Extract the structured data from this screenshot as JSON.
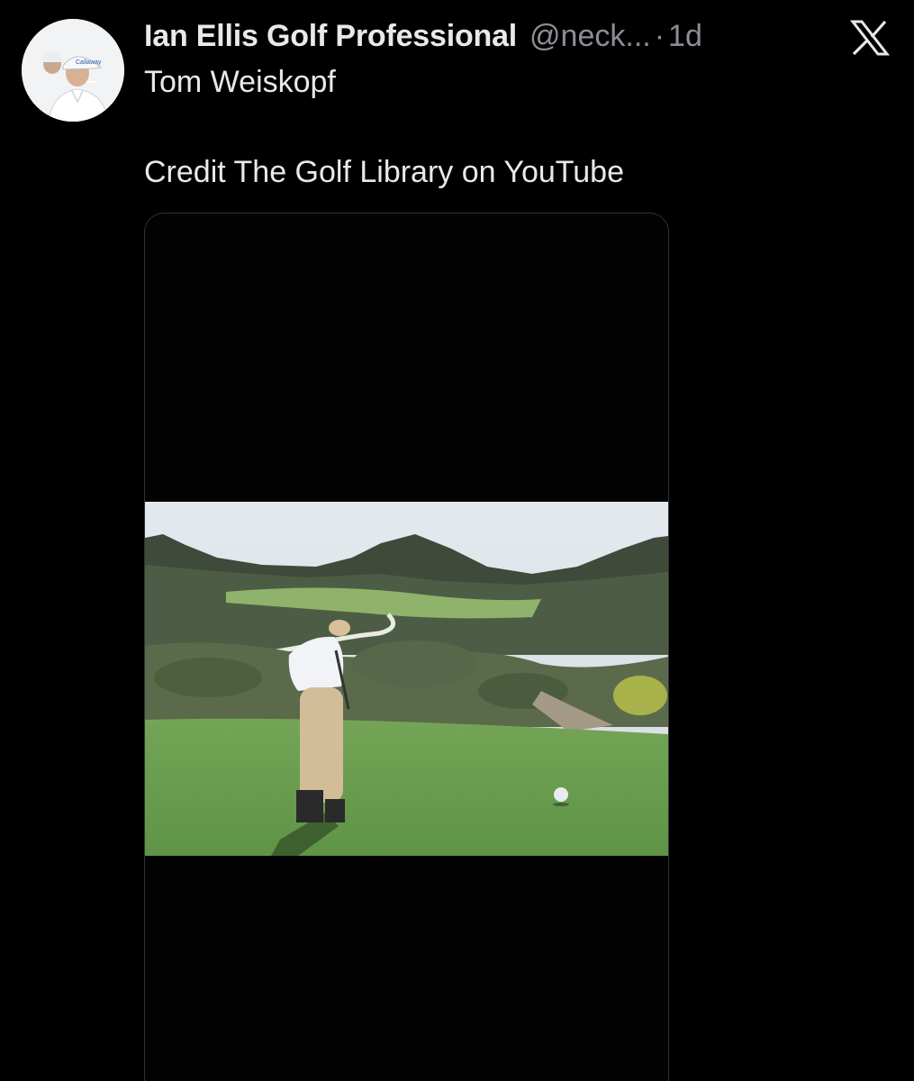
{
  "post": {
    "author_name": "Ian Ellis Golf Professional",
    "author_handle": "@neck...",
    "separator": "·",
    "time": "1d",
    "text_line_1": "Tom Weiskopf",
    "text_line_2": "Credit The Golf Library on YouTube"
  },
  "icons": {
    "avatar": "avatar-image",
    "close": "x-logo-icon",
    "media": "video-thumbnail"
  },
  "colors": {
    "background": "#000000",
    "text_primary": "#e7e9ea",
    "text_secondary": "#8b8f94",
    "media_border": "#2f3336"
  }
}
